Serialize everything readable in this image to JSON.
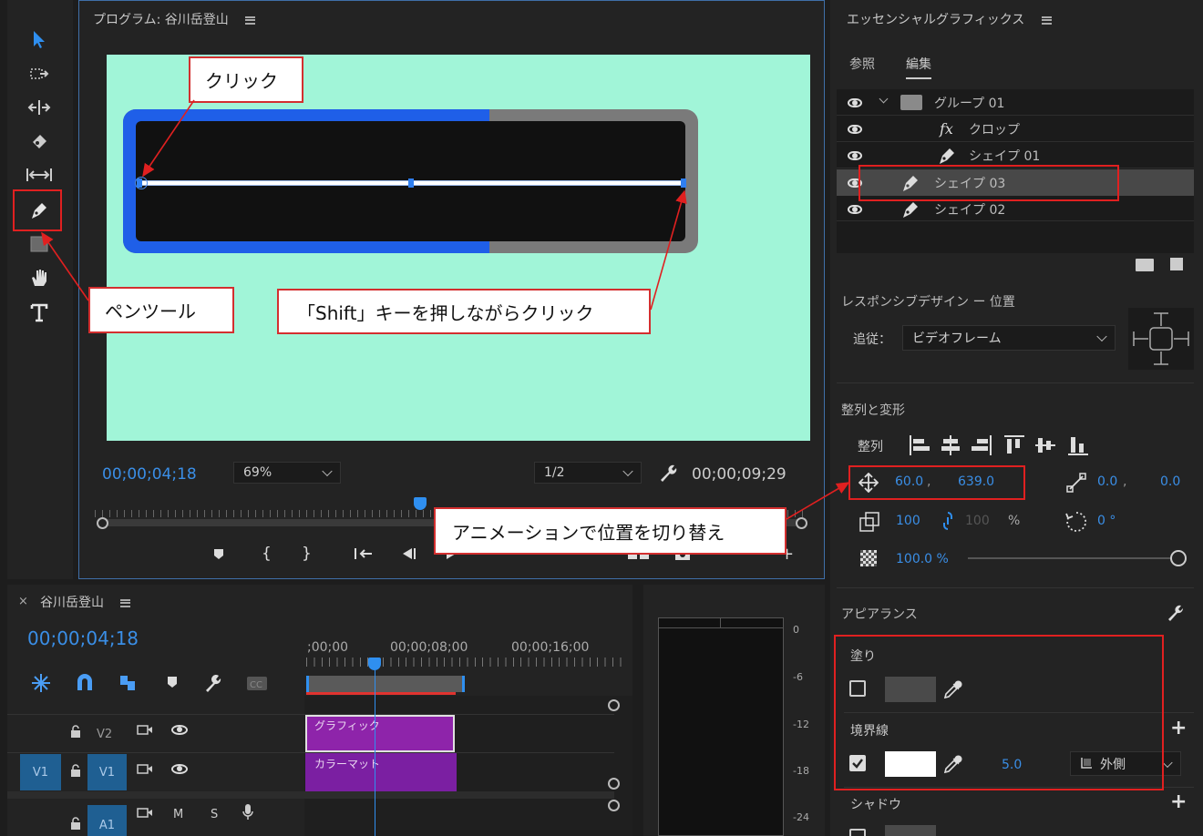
{
  "program_monitor": {
    "title": "プログラム: 谷川岳登山",
    "timecode_current": "00;00;04;18",
    "zoom": "69%",
    "resolution": "1/2",
    "timecode_duration": "00;00;09;29"
  },
  "essential_graphics": {
    "title": "エッセンシャルグラフィックス",
    "tabs": [
      "参照",
      "編集"
    ],
    "layers": [
      {
        "name": "グループ 01",
        "kind": "folder"
      },
      {
        "name": "クロップ",
        "kind": "fx"
      },
      {
        "name": "シェイプ 01",
        "kind": "pen"
      },
      {
        "name": "シェイプ 03",
        "kind": "pen"
      },
      {
        "name": "シェイプ 02",
        "kind": "pen"
      }
    ],
    "responsive_title": "レスポンシブデザイン ー 位置",
    "follow_label": "追従：",
    "follow_value": "ビデオフレーム",
    "align_section": "整列と変形",
    "align_label": "整列",
    "position_x": "60.0",
    "position_sep": ",",
    "position_y": "639.0",
    "anchor_x": "0.0",
    "anchor_sep": ",",
    "anchor_y": "0.0",
    "scale": "100",
    "scale_h": "100",
    "scale_unit": "%",
    "rotation": "0 °",
    "opacity": "100.0 %",
    "appearance_title": "アピアランス",
    "fill_label": "塗り",
    "stroke_label": "境界線",
    "stroke_width": "5.0",
    "stroke_type": "外側",
    "shadow_label": "シャドウ",
    "fill_color": "#4a4a4a",
    "stroke_color": "#ffffff"
  },
  "timeline": {
    "title": "谷川岳登山",
    "timecode": "00;00;04;18",
    "ruler_labels": [
      ";00;00",
      "00;00;08;00",
      "00;00;16;00"
    ],
    "tracks": [
      {
        "target": "",
        "name": "V2"
      },
      {
        "target": "V1",
        "name": "V1"
      },
      {
        "target": "",
        "name": "A1"
      }
    ],
    "audio_buttons": [
      "M",
      "S"
    ],
    "clips": [
      "グラフィック",
      "カラーマット"
    ]
  },
  "audio_meter": {
    "labels": [
      "0",
      "-6",
      "-12",
      "-18",
      "-24"
    ]
  },
  "callouts": {
    "click": "クリック",
    "pen_tool": "ペンツール",
    "shift_click": "「Shift」キーを押しながらクリック",
    "animation": "アニメーションで位置を切り替え"
  },
  "colors": {
    "accent_blue": "#3a8ee6",
    "canvas_bg": "#a1f5d8",
    "bar_blue": "#1f5fe8",
    "bar_gray": "#7a7a7a",
    "callout_border": "#d32f2f",
    "clip_purple": "#8e24aa"
  }
}
